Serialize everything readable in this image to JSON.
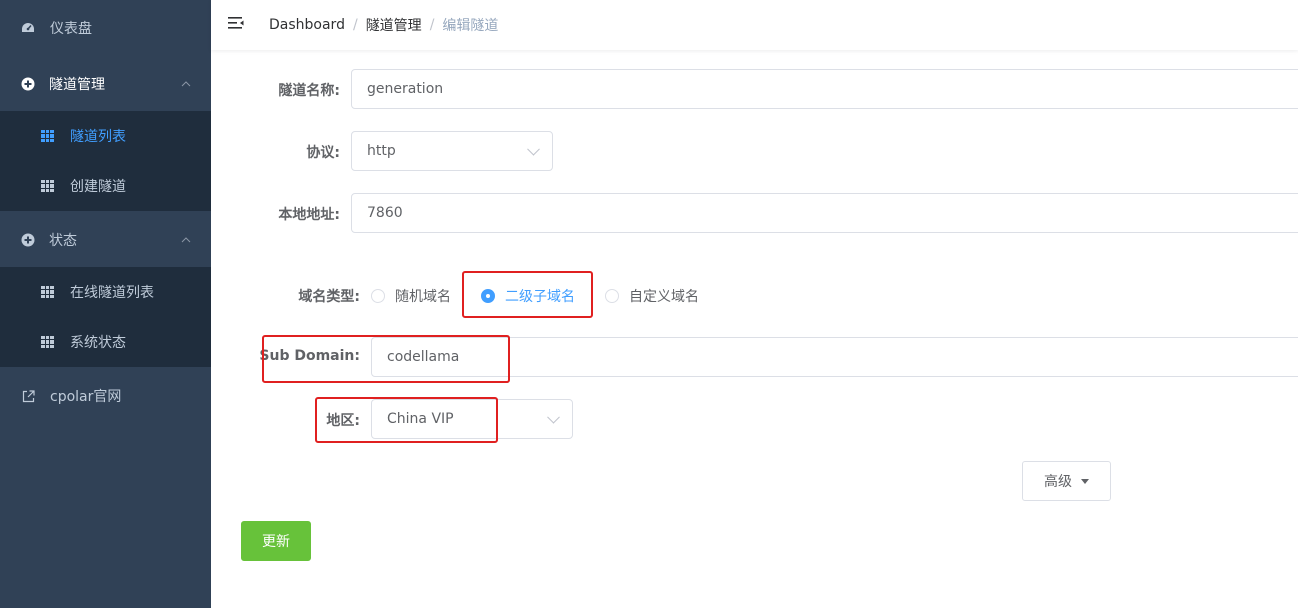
{
  "sidebar": {
    "items": [
      {
        "label": "仪表盘",
        "icon": "dashboard-icon"
      },
      {
        "label": "隧道管理",
        "icon": "plus-circle-icon"
      },
      {
        "label": "状态",
        "icon": "plus-circle-icon"
      },
      {
        "label": "cpolar官网",
        "icon": "external-link-icon"
      }
    ],
    "tunnel_sub": [
      {
        "label": "隧道列表",
        "active": true
      },
      {
        "label": "创建隧道",
        "active": false
      }
    ],
    "status_sub": [
      {
        "label": "在线隧道列表"
      },
      {
        "label": "系统状态"
      }
    ]
  },
  "breadcrumb": [
    "Dashboard",
    "隧道管理",
    "编辑隧道"
  ],
  "form": {
    "name_label": "隧道名称:",
    "name_value": "generation",
    "protocol_label": "协议:",
    "protocol_value": "http",
    "local_label": "本地地址:",
    "local_value": "7860",
    "domain_type_label": "域名类型:",
    "domain_types": [
      "随机域名",
      "二级子域名",
      "自定义域名"
    ],
    "domain_type_selected": "二级子域名",
    "subdomain_label": "Sub Domain:",
    "subdomain_value": "codellama",
    "region_label": "地区:",
    "region_value": "China VIP",
    "advanced_label": "高级",
    "update_label": "更新"
  },
  "colors": {
    "sidebar_bg": "#304156",
    "submenu_bg": "#1f2d3d",
    "accent": "#409eff",
    "success": "#67c23a",
    "highlight": "#e02020"
  }
}
